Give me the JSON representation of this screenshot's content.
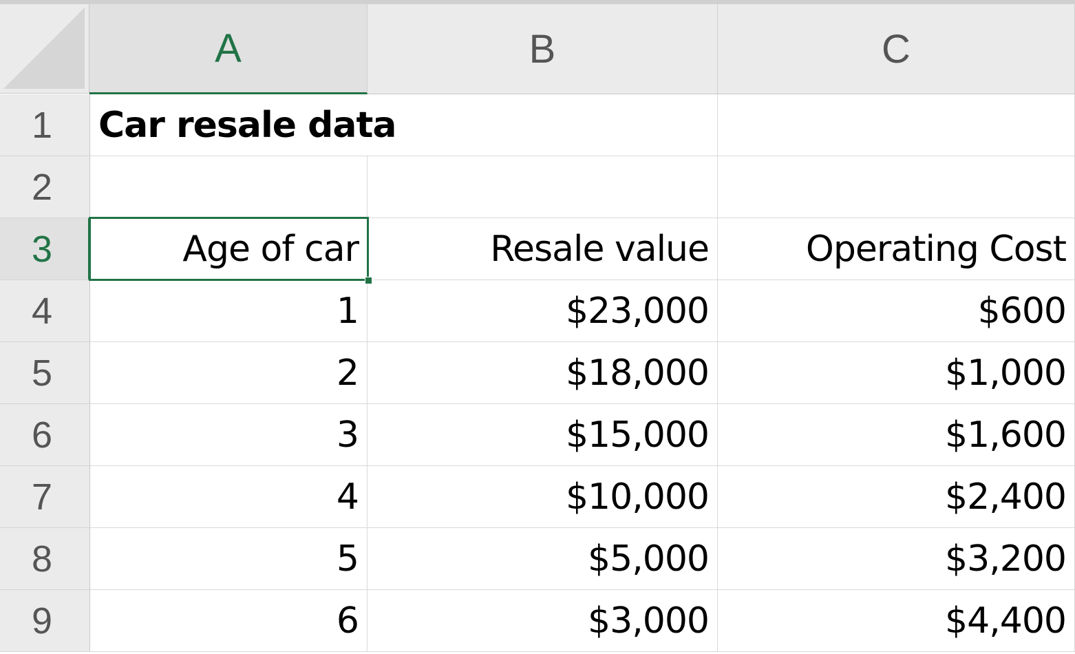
{
  "columns": [
    {
      "label": "A",
      "active": true
    },
    {
      "label": "B",
      "active": false
    },
    {
      "label": "C",
      "active": false
    }
  ],
  "rows": [
    {
      "number": "1",
      "active": false,
      "cells": [
        "Car resale data",
        "",
        ""
      ]
    },
    {
      "number": "2",
      "active": false,
      "cells": [
        "",
        "",
        ""
      ]
    },
    {
      "number": "3",
      "active": true,
      "cells": [
        "Age of car",
        "Resale value",
        "Operating Cost"
      ]
    },
    {
      "number": "4",
      "active": false,
      "cells": [
        "1",
        "$23,000",
        "$600"
      ]
    },
    {
      "number": "5",
      "active": false,
      "cells": [
        "2",
        "$18,000",
        "$1,000"
      ]
    },
    {
      "number": "6",
      "active": false,
      "cells": [
        "3",
        "$15,000",
        "$1,600"
      ]
    },
    {
      "number": "7",
      "active": false,
      "cells": [
        "4",
        "$10,000",
        "$2,400"
      ]
    },
    {
      "number": "8",
      "active": false,
      "cells": [
        "5",
        "$5,000",
        "$3,200"
      ]
    },
    {
      "number": "9",
      "active": false,
      "cells": [
        "6",
        "$3,000",
        "$4,400"
      ]
    }
  ],
  "selected_cell": "A3",
  "colors": {
    "accent": "#217346",
    "header_bg": "#ebebeb",
    "grid": "#d9d9d9"
  }
}
